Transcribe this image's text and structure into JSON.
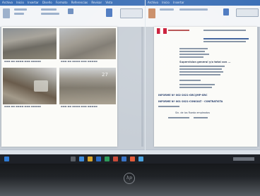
{
  "scene": {
    "description_free": true,
    "left_window": {
      "doc_figure_labels": [
        "27"
      ],
      "tab_labels": [
        "Archivo",
        "Inicio",
        "Insertar",
        "Diseño",
        "Formato",
        "Referencias",
        "Revisar",
        "Vista"
      ]
    },
    "right_window": {
      "heading_lines": [
        "INFORME Nº 002-2021-GRC/JMP-GRC",
        "INFORME Nº 001-2021-CONSULT - CONTRATISTA"
      ],
      "section_title": "Supervision general y/o total con ...",
      "footer_line": "Sin. de los Rueda empleados"
    },
    "laptop_brand": "hp"
  },
  "colors": {
    "ribbon": "#3b6fb6",
    "taskbar": "#1e2127",
    "bezel": "#16181b"
  }
}
